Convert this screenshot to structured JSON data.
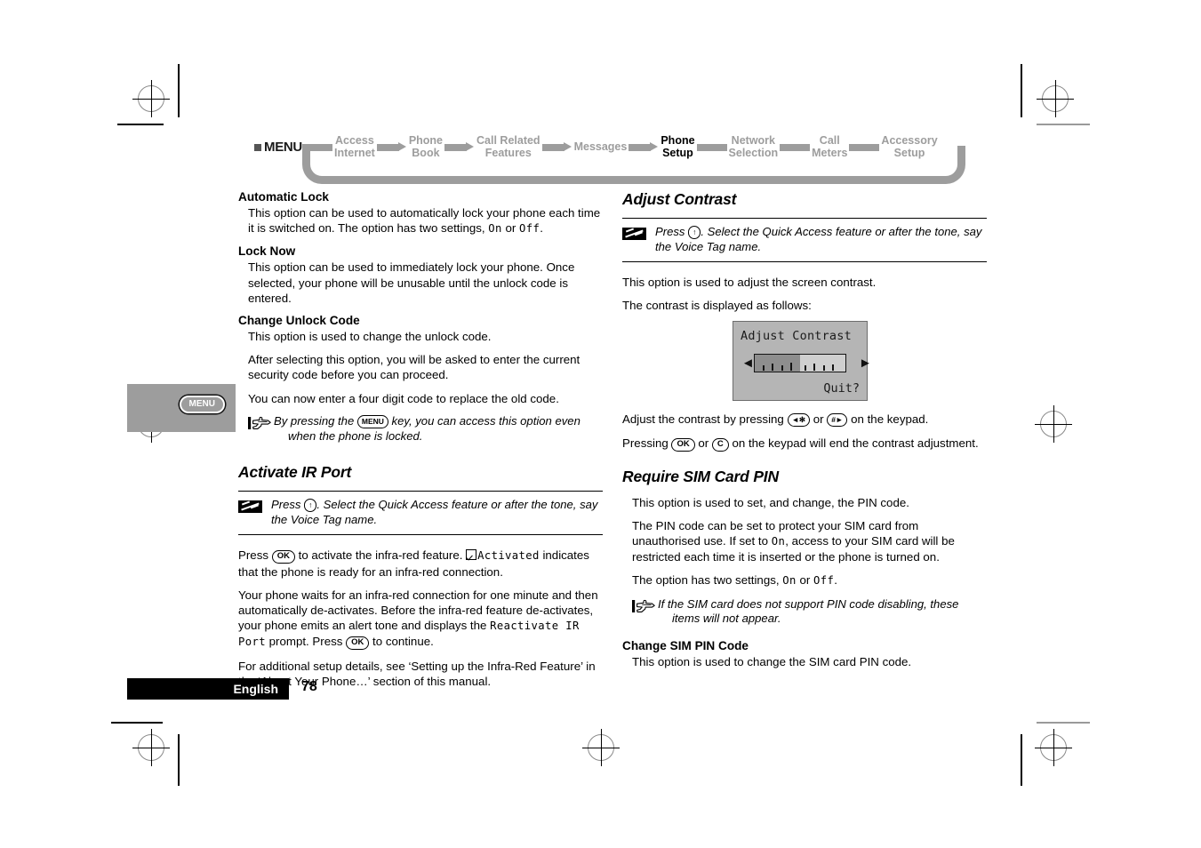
{
  "nav": {
    "menu_label": "MENU",
    "items": [
      {
        "label": "Access\nInternet",
        "active": false
      },
      {
        "label": "Phone\nBook",
        "active": false
      },
      {
        "label": "Call Related\nFeatures",
        "active": false
      },
      {
        "label": "Messages",
        "active": false
      },
      {
        "label": "Phone\nSetup",
        "active": true
      },
      {
        "label": "Network\nSelection",
        "active": false
      },
      {
        "label": "Call\nMeters",
        "active": false
      },
      {
        "label": "Accessory\nSetup",
        "active": false
      }
    ]
  },
  "thumb_tab": {
    "key_label": "MENU"
  },
  "left_column": {
    "automatic_lock": {
      "heading": "Automatic Lock",
      "p1_a": "This option can be used to automatically lock your phone each time it is switched on. The option has two settings, ",
      "p1_on": "On",
      "p1_b": " or ",
      "p1_off": "Off",
      "p1_c": "."
    },
    "lock_now": {
      "heading": "Lock Now",
      "p1": "This option can be used to immediately lock your phone. Once selected, your phone will be unusable until the unlock code is entered."
    },
    "change_unlock_code": {
      "heading": "Change Unlock Code",
      "p1": "This option is used to change the unlock code.",
      "p2": "After selecting this option, you will be asked to enter the current security code before you can proceed.",
      "p3": "You can now enter a four digit code to replace the old code.",
      "tip_a": "By pressing the ",
      "tip_key": "MENU",
      "tip_b": " key, you can access this option even ",
      "tip_c": "when the phone is locked."
    },
    "activate_ir_port": {
      "heading": "Activate IR Port",
      "voice_a": "Press ",
      "voice_key": "↑",
      "voice_b": ". Select the Quick Access feature or after the tone, say the Voice Tag name.",
      "p1_a": "Press ",
      "p1_key": "OK",
      "p1_b": " to activate the infra-red feature. ",
      "p1_mono": "Activated",
      "p1_c": " indicates that the phone is ready for an infra-red connection.",
      "p2_a": "Your phone waits for an infra-red connection for one minute and then automatically de-activates. Before the infra-red feature de-activates, your phone emits an alert tone and displays the ",
      "p2_mono": "Reactivate IR Port",
      "p2_b": " prompt. Press ",
      "p2_key": "OK",
      "p2_c": " to continue.",
      "p3": "For additional setup details, see ‘Setting up the Infra-Red Feature’ in the ‘About Your Phone…’ section of this manual."
    }
  },
  "right_column": {
    "adjust_contrast": {
      "heading": "Adjust Contrast",
      "voice_a": "Press ",
      "voice_key": "↑",
      "voice_b": ". Select the Quick Access feature or after the tone, say the Voice Tag name.",
      "p1": "This option is used to adjust the screen contrast.",
      "p2": "The contrast is displayed as follows:",
      "screen": {
        "title": "Adjust Contrast",
        "quit": "Quit?",
        "fill_percent": 50,
        "arrow_left": "◄",
        "arrow_right": "►"
      },
      "p3_a": "Adjust the contrast by pressing ",
      "p3_key1": "◄✻",
      "p3_b": " or ",
      "p3_key2": "#►",
      "p3_c": " on the keypad.",
      "p4_a": "Pressing ",
      "p4_key1": "OK",
      "p4_b": " or ",
      "p4_key2": "C",
      "p4_c": " on the keypad will end the contrast adjustment."
    },
    "require_sim_card_pin": {
      "heading": "Require SIM Card PIN",
      "p1": "This option is used to set, and change, the PIN code.",
      "p2_a": "The PIN code can be set to protect your SIM card from unauthorised use. If set to ",
      "p2_on": "On",
      "p2_b": ", access to your SIM card will be restricted each time it is inserted or the phone is turned on.",
      "p3_a": "The option has two settings, ",
      "p3_on": "On",
      "p3_b": " or ",
      "p3_off": "Off",
      "p3_c": ".",
      "tip_a": "If the SIM card does not support PIN code disabling, these ",
      "tip_b": "items will not appear."
    },
    "change_sim_pin_code": {
      "heading": "Change SIM PIN Code",
      "p1": "This option is used to change the SIM card PIN code."
    }
  },
  "footer": {
    "language": "English",
    "page_number": "78"
  }
}
